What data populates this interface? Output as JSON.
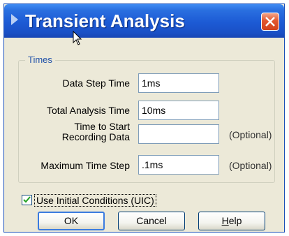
{
  "window": {
    "title": "Transient Analysis"
  },
  "titlebar_icons": {
    "system": "play-arrow-icon",
    "close": "close-icon",
    "cursor": "mouse-pointer-icon"
  },
  "group": {
    "label": "Times"
  },
  "fields": [
    {
      "label": "Data Step Time",
      "value": "1ms",
      "optional": ""
    },
    {
      "label": "Total Analysis Time",
      "value": "10ms",
      "optional": ""
    },
    {
      "label_line1": "Time to Start",
      "label_line2": "Recording Data",
      "value": "",
      "optional": "(Optional)"
    },
    {
      "label": "Maximum Time Step",
      "value": ".1ms",
      "optional": "(Optional)"
    }
  ],
  "checkbox": {
    "label": "Use Initial Conditions (UIC)",
    "checked": true
  },
  "buttons": {
    "ok": "OK",
    "cancel": "Cancel",
    "help_rest": "elp",
    "help_mnemonic": "H"
  },
  "colors": {
    "titlebar": "#1c5ad4",
    "close": "#e2562e",
    "dialog_bg": "#ece9d8",
    "group_label": "#1d4fa8"
  }
}
